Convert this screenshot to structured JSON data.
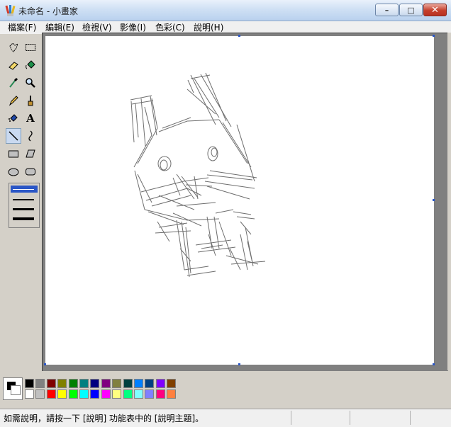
{
  "window": {
    "title": "未命名 - 小畫家",
    "icon": "paint-app-icon",
    "controls": [
      "minimize-icon",
      "maximize-icon",
      "close-icon"
    ]
  },
  "menu": {
    "items": [
      {
        "label": "檔案(F)"
      },
      {
        "label": "編輯(E)"
      },
      {
        "label": "檢視(V)"
      },
      {
        "label": "影像(I)"
      },
      {
        "label": "色彩(C)"
      },
      {
        "label": "說明(H)"
      }
    ]
  },
  "tools": [
    {
      "name": "free-form-select-icon"
    },
    {
      "name": "rect-select-icon"
    },
    {
      "name": "eraser-icon"
    },
    {
      "name": "fill-bucket-icon"
    },
    {
      "name": "pick-color-icon"
    },
    {
      "name": "magnifier-icon"
    },
    {
      "name": "pencil-icon"
    },
    {
      "name": "brush-icon"
    },
    {
      "name": "airbrush-icon"
    },
    {
      "name": "text-icon",
      "label": "A"
    },
    {
      "name": "line-icon",
      "active": true
    },
    {
      "name": "curve-icon"
    },
    {
      "name": "rectangle-icon"
    },
    {
      "name": "polygon-icon"
    },
    {
      "name": "ellipse-icon"
    },
    {
      "name": "rounded-rect-icon"
    }
  ],
  "line_width_options": [
    1,
    2,
    3,
    4
  ],
  "line_width_selected": 1,
  "palette": {
    "foreground": "#000000",
    "background": "#ffffff",
    "row1": [
      "#000000",
      "#808080",
      "#800000",
      "#808000",
      "#008000",
      "#008080",
      "#000080",
      "#800080",
      "#808040",
      "#004040",
      "#0080ff",
      "#004080",
      "#8000ff",
      "#804000"
    ],
    "row2": [
      "#ffffff",
      "#c0c0c0",
      "#ff0000",
      "#ffff00",
      "#00ff00",
      "#00ffff",
      "#0000ff",
      "#ff00ff",
      "#ffff80",
      "#00ff80",
      "#80ffff",
      "#8080ff",
      "#ff0080",
      "#ff8040"
    ]
  },
  "status": {
    "text": "如需說明，請按一下 [說明] 功能表中的 [說明主題]。"
  },
  "colors": {
    "canvas": "#ffffff",
    "workspace": "#808080",
    "sketch_stroke": "#6e6e6e"
  }
}
